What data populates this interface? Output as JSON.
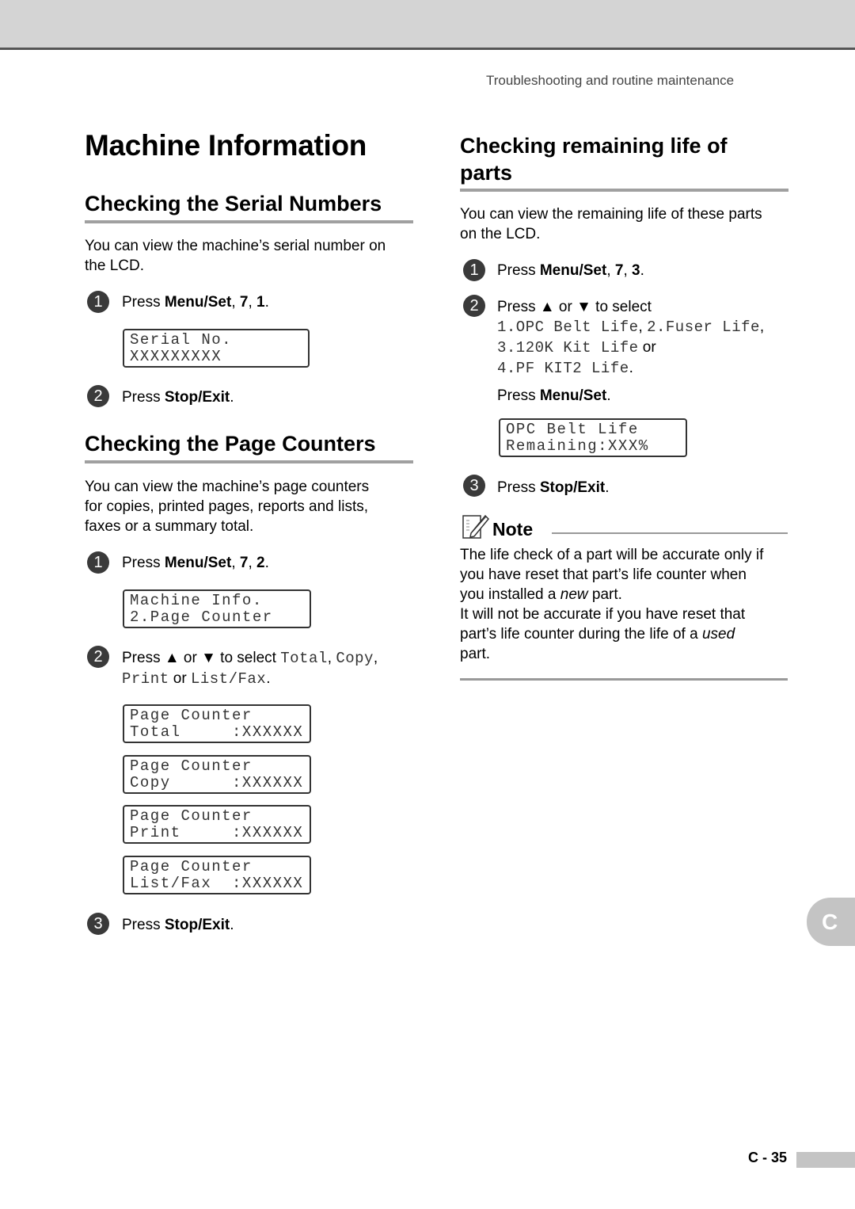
{
  "header": {
    "running_head": "Troubleshooting and routine maintenance"
  },
  "title": "Machine Information",
  "serial": {
    "heading": "Checking the Serial Numbers",
    "intro_line1": "You can view the machine’s serial number on",
    "intro_line2": "the LCD.",
    "step1": {
      "num": "1",
      "prefix": "Press ",
      "bold1": "Menu/Set",
      "sep1": ", ",
      "bold2": "7",
      "sep2": ", ",
      "bold3": "1",
      "end": "."
    },
    "lcd": {
      "line1": "Serial No.",
      "line2": "XXXXXXXXX"
    },
    "step2": {
      "num": "2",
      "prefix": "Press ",
      "bold": "Stop/Exit",
      "end": "."
    }
  },
  "counters": {
    "heading": "Checking the Page Counters",
    "intro_line1": "You can view the machine’s page counters",
    "intro_line2": "for copies, printed pages, reports and lists,",
    "intro_line3": "faxes or a summary total.",
    "step1": {
      "num": "1",
      "prefix": "Press ",
      "bold1": "Menu/Set",
      "sep1": ", ",
      "bold2": "7",
      "sep2": ", ",
      "bold3": "2",
      "end": "."
    },
    "lcd_menu": {
      "line1": "Machine Info.",
      "line2": "2.Page Counter"
    },
    "step2": {
      "num": "2",
      "prefix": "Press ▲ or ▼ to select ",
      "opt1": "Total",
      "c1": ", ",
      "opt2": "Copy",
      "c2": ",",
      "opt3": "Print",
      "or": " or ",
      "opt4": "List/Fax",
      "end": "."
    },
    "lcds": [
      {
        "line1": "Page Counter",
        "line2": "Total     :XXXXXX"
      },
      {
        "line1": "Page Counter",
        "line2": "Copy      :XXXXXX"
      },
      {
        "line1": "Page Counter",
        "line2": "Print     :XXXXXX"
      },
      {
        "line1": "Page Counter",
        "line2": "List/Fax  :XXXXXX"
      }
    ],
    "step3": {
      "num": "3",
      "prefix": "Press ",
      "bold": "Stop/Exit",
      "end": "."
    }
  },
  "parts": {
    "heading_line1": "Checking remaining life of",
    "heading_line2": "parts",
    "intro_line1": "You can view the remaining life of these parts",
    "intro_line2": "on the LCD.",
    "step1": {
      "num": "1",
      "prefix": "Press ",
      "bold1": "Menu/Set",
      "sep1": ", ",
      "bold2": "7",
      "sep2": ", ",
      "bold3": "3",
      "end": "."
    },
    "step2": {
      "num": "2",
      "text": "Press ▲ or ▼ to select",
      "opt1": "1.OPC Belt Life",
      "c1": ", ",
      "opt2": "2.Fuser Life",
      "c2": ",",
      "opt3": "3.120K Kit Life",
      "or": " or",
      "opt4": "4.PF KIT2 Life",
      "end": ".",
      "press_prefix": "Press ",
      "press_bold": "Menu/Set",
      "press_end": "."
    },
    "lcd": {
      "line1": "OPC Belt Life",
      "line2": "Remaining:XXX%"
    },
    "step3": {
      "num": "3",
      "prefix": "Press ",
      "bold": "Stop/Exit",
      "end": "."
    }
  },
  "note": {
    "label": "Note",
    "icon": "note-pencil-icon",
    "p1_line1": "The life check of a part will be accurate only if",
    "p1_line2": "you have reset that part’s life counter when",
    "p1_line3_pre": "you installed a ",
    "p1_line3_em": "new",
    "p1_line3_post": " part.",
    "p2_line1": "It will not be accurate if you have reset that",
    "p2_line2_pre": "part’s life counter during the life of a ",
    "p2_line2_em": "used",
    "p2_line3": "part."
  },
  "side_tab": "C",
  "footer": {
    "page_number": "C - 35"
  }
}
